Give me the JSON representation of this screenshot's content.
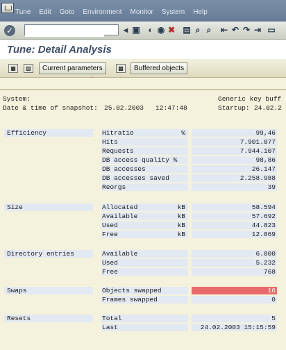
{
  "menu": [
    "Tune",
    "Edit",
    "Goto",
    "Environment",
    "Monitor",
    "System",
    "Help"
  ],
  "title": "Tune: Detail Analysis",
  "buttons": {
    "current_parameters": "Current parameters",
    "buffered_objects": "Buffered objects"
  },
  "header": {
    "system_label": "System:",
    "snapshot_label": "Date & time of snapshot:",
    "snapshot_value": "25.02.2003   12:47:48",
    "buffer_type": "Generic key buff",
    "startup_label": "Startup:",
    "startup_value": "24.02.2"
  },
  "sections": {
    "efficiency": {
      "label": "Efficiency",
      "rows": [
        {
          "metric": "Hitratio",
          "unit": "%",
          "value": "99,46"
        },
        {
          "metric": "Hits",
          "unit": "",
          "value": "7.901.077"
        },
        {
          "metric": "Requests",
          "unit": "",
          "value": "7.944.107"
        },
        {
          "metric": "DB access quality %",
          "unit": "",
          "value": "98,86"
        },
        {
          "metric": "DB accesses",
          "unit": "",
          "value": "26.147"
        },
        {
          "metric": "DB accesses saved",
          "unit": "",
          "value": "2.258.988"
        },
        {
          "metric": "Reorgs",
          "unit": "",
          "value": "39"
        }
      ]
    },
    "size": {
      "label": "Size",
      "rows": [
        {
          "metric": "Allocated",
          "unit": "kB",
          "value": "58.594"
        },
        {
          "metric": "Available",
          "unit": "kB",
          "value": "57.692"
        },
        {
          "metric": "Used",
          "unit": "kB",
          "value": "44.823"
        },
        {
          "metric": "Free",
          "unit": "kB",
          "value": "12.869"
        }
      ]
    },
    "directory": {
      "label": "Directory entries",
      "rows": [
        {
          "metric": "Available",
          "unit": "",
          "value": "6.000"
        },
        {
          "metric": "Used",
          "unit": "",
          "value": "5.232"
        },
        {
          "metric": "Free",
          "unit": "",
          "value": "768"
        }
      ]
    },
    "swaps": {
      "label": "Swaps",
      "rows": [
        {
          "metric": "Objects swapped",
          "unit": "",
          "value": "16"
        },
        {
          "metric": "Frames swapped",
          "unit": "",
          "value": "0"
        }
      ]
    },
    "resets": {
      "label": "Resets",
      "rows": [
        {
          "metric": "Total",
          "unit": "",
          "value": "5"
        },
        {
          "metric": "Last",
          "unit": "",
          "value": "24.02.2003 15:15:59"
        }
      ]
    }
  },
  "colors": {
    "alert": "#e86a6a",
    "field_bg": "#e3e9f2",
    "area_bg": "#f4f2dc"
  }
}
